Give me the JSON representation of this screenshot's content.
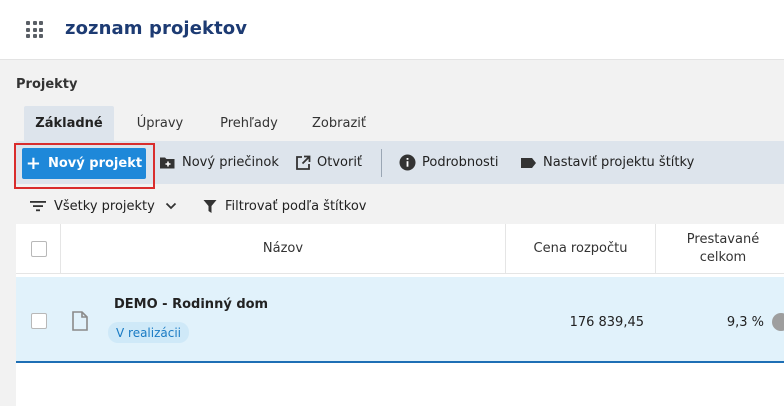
{
  "header": {
    "title": "zoznam projektov",
    "apps_icon": "apps-grid-icon"
  },
  "section": {
    "title": "Projekty"
  },
  "tabs": [
    {
      "label": "Základné",
      "active": true
    },
    {
      "label": "Úpravy",
      "active": false
    },
    {
      "label": "Prehľady",
      "active": false
    },
    {
      "label": "Zobraziť",
      "active": false
    }
  ],
  "toolbar": {
    "new_project": "Nový projekt",
    "new_folder": "Nový priečinok",
    "open": "Otvoriť",
    "details": "Podrobnosti",
    "set_tags": "Nastaviť projektu štítky"
  },
  "filters": {
    "all_projects": "Všetky projekty",
    "filter_by_tags": "Filtrovať podľa štítkov"
  },
  "table": {
    "columns": [
      "Názov",
      "Cena rozpočtu",
      "Prestavané celkom"
    ],
    "rows": [
      {
        "name": "DEMO - Rodinný dom",
        "status": "V realizácii",
        "price": "176 839,45",
        "built_percent": "9,3 %"
      }
    ]
  },
  "colors": {
    "primary": "#1e88d9",
    "title_blue": "#1d3b73",
    "highlight_red": "#d92d2d",
    "row_selected": "#e1f2fb",
    "toolbar_bg": "#dde4ec"
  }
}
